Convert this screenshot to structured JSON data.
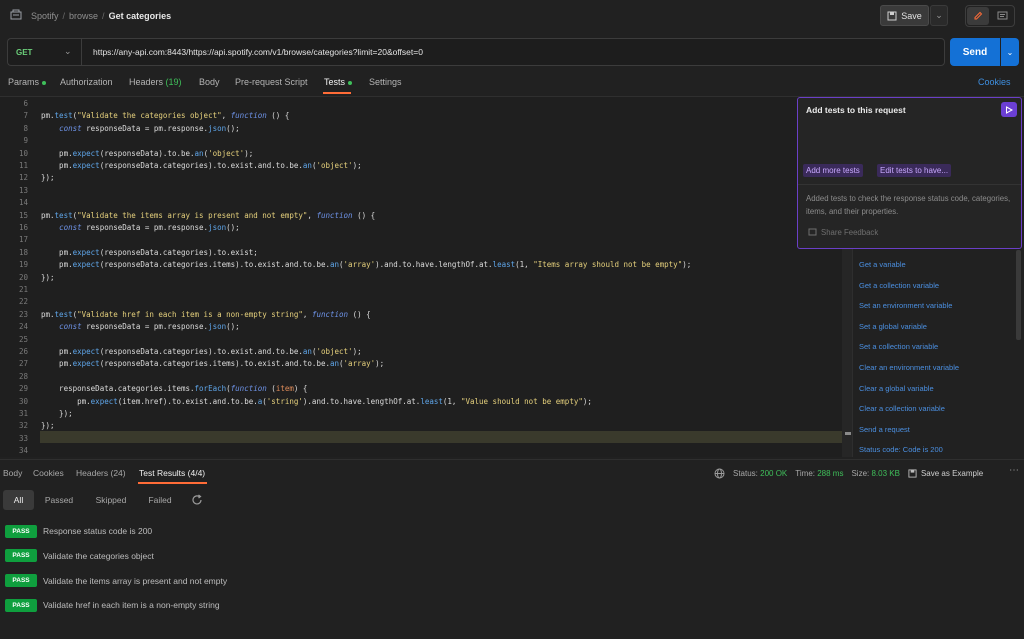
{
  "header": {
    "breadcrumb": {
      "workspace": "Spotify",
      "folder": "browse",
      "current": "Get categories"
    },
    "save_label": "Save"
  },
  "request": {
    "method": "GET",
    "url": "https://any-api.com:8443/https://api.spotify.com/v1/browse/categories?limit=20&offset=0",
    "send_label": "Send"
  },
  "request_tabs": {
    "params": "Params",
    "authorization": "Authorization",
    "headers": "Headers",
    "headers_count": "(19)",
    "body": "Body",
    "prerequest": "Pre-request Script",
    "tests": "Tests",
    "settings": "Settings",
    "cookies": "Cookies"
  },
  "editor": {
    "line_numbers": [
      "6",
      "7",
      "8",
      "9",
      "10",
      "11",
      "12",
      "13",
      "14",
      "15",
      "16",
      "17",
      "18",
      "19",
      "20",
      "21",
      "22",
      "23",
      "24",
      "25",
      "26",
      "27",
      "28",
      "29",
      "30",
      "31",
      "32",
      "33",
      "34"
    ]
  },
  "ai_panel": {
    "title": "Add tests to this request",
    "add_more": "Add more tests",
    "edit_tests": "Edit tests to have...",
    "description": "Added tests to check the response status code, categories, items, and their properties.",
    "feedback": "Share Feedback"
  },
  "snippets": [
    "Get a variable",
    "Get a collection variable",
    "Set an environment variable",
    "Set a global variable",
    "Set a collection variable",
    "Clear an environment variable",
    "Clear a global variable",
    "Clear a collection variable",
    "Send a request",
    "Status code: Code is 200"
  ],
  "response_tabs": {
    "body": "Body",
    "cookies": "Cookies",
    "headers": "Headers (24)",
    "test_results": "Test Results (4/4)"
  },
  "status": {
    "status_label": "Status:",
    "status_value": "200 OK",
    "time_label": "Time:",
    "time_value": "288 ms",
    "size_label": "Size:",
    "size_value": "8.03 KB",
    "save_example": "Save as Example"
  },
  "filters": {
    "all": "All",
    "passed": "Passed",
    "skipped": "Skipped",
    "failed": "Failed"
  },
  "results": [
    {
      "badge": "PASS",
      "name": "Response status code is 200"
    },
    {
      "badge": "PASS",
      "name": "Validate the categories object"
    },
    {
      "badge": "PASS",
      "name": "Validate the items array is present and not empty"
    },
    {
      "badge": "PASS",
      "name": "Validate href in each item is a non-empty string"
    }
  ],
  "colors": {
    "accent": "#ff6c37",
    "send": "#1471d6",
    "pass": "#0f9f3e",
    "ai": "#6b3fd4"
  }
}
